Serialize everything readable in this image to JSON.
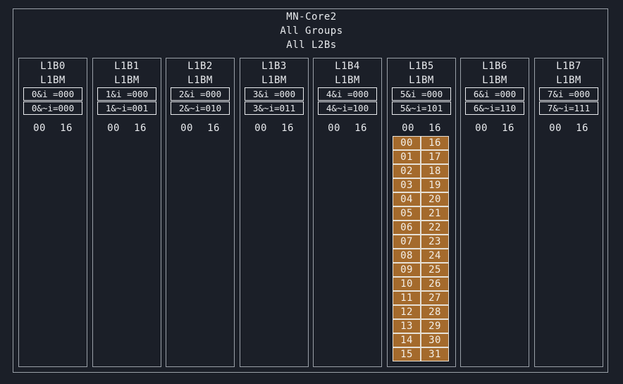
{
  "header": {
    "lines": [
      "MN-Core2",
      "All Groups",
      "All L2Bs"
    ]
  },
  "blocks": [
    {
      "name": "L1B0",
      "sub": "L1BM",
      "cond1": "0&i =000",
      "cond2": "0&~i=000",
      "col_left": "00",
      "col_right": "16",
      "cells": []
    },
    {
      "name": "L1B1",
      "sub": "L1BM",
      "cond1": "1&i =000",
      "cond2": "1&~i=001",
      "col_left": "00",
      "col_right": "16",
      "cells": []
    },
    {
      "name": "L1B2",
      "sub": "L1BM",
      "cond1": "2&i =000",
      "cond2": "2&~i=010",
      "col_left": "00",
      "col_right": "16",
      "cells": []
    },
    {
      "name": "L1B3",
      "sub": "L1BM",
      "cond1": "3&i =000",
      "cond2": "3&~i=011",
      "col_left": "00",
      "col_right": "16",
      "cells": []
    },
    {
      "name": "L1B4",
      "sub": "L1BM",
      "cond1": "4&i =000",
      "cond2": "4&~i=100",
      "col_left": "00",
      "col_right": "16",
      "cells": []
    },
    {
      "name": "L1B5",
      "sub": "L1BM",
      "cond1": "5&i =000",
      "cond2": "5&~i=101",
      "col_left": "00",
      "col_right": "16",
      "cells": [
        [
          "00",
          "16"
        ],
        [
          "01",
          "17"
        ],
        [
          "02",
          "18"
        ],
        [
          "03",
          "19"
        ],
        [
          "04",
          "20"
        ],
        [
          "05",
          "21"
        ],
        [
          "06",
          "22"
        ],
        [
          "07",
          "23"
        ],
        [
          "08",
          "24"
        ],
        [
          "09",
          "25"
        ],
        [
          "10",
          "26"
        ],
        [
          "11",
          "27"
        ],
        [
          "12",
          "28"
        ],
        [
          "13",
          "29"
        ],
        [
          "14",
          "30"
        ],
        [
          "15",
          "31"
        ]
      ]
    },
    {
      "name": "L1B6",
      "sub": "L1BM",
      "cond1": "6&i =000",
      "cond2": "6&~i=110",
      "col_left": "00",
      "col_right": "16",
      "cells": []
    },
    {
      "name": "L1B7",
      "sub": "L1BM",
      "cond1": "7&i =000",
      "cond2": "7&~i=111",
      "col_left": "00",
      "col_right": "16",
      "cells": []
    }
  ],
  "colors": {
    "background": "#1b1f28",
    "border": "#9aa0a8",
    "text": "#e9ebee",
    "cell_fill": "#a46a2c"
  }
}
